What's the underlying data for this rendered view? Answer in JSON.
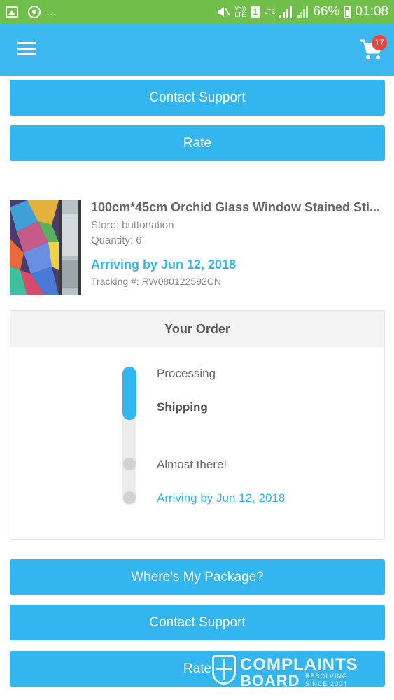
{
  "status_bar": {
    "dots": "...",
    "battery": "66%",
    "time": "01:08",
    "volte": "Vo))\nLTE",
    "sim": "1",
    "lte": "LTE"
  },
  "header": {
    "cart_count": "17"
  },
  "buttons": {
    "contact_support": "Contact Support",
    "rate": "Rate",
    "wheres_package": "Where's My Package?"
  },
  "product": {
    "title": "100cm*45cm Orchid Glass Window Stained Sti...",
    "store": "Store: buttonation",
    "quantity": "Quantity: 6",
    "arriving": "Arriving by Jun 12, 2018",
    "tracking": "Tracking #: RW080122592CN"
  },
  "order": {
    "heading": "Your Order",
    "steps": [
      "Processing",
      "Shipping",
      "Almost there!",
      "Arriving by Jun 12, 2018"
    ]
  },
  "watermark": {
    "line1": "COMPLAINTS",
    "line2": "BOARD",
    "line3": "RESOLVING",
    "line4": "SINCE 2004"
  },
  "colors": {
    "status_bar": "#6fbf4a",
    "app_bar": "#3db7f0",
    "button": "#33b5ef",
    "badge": "#e8473f"
  }
}
